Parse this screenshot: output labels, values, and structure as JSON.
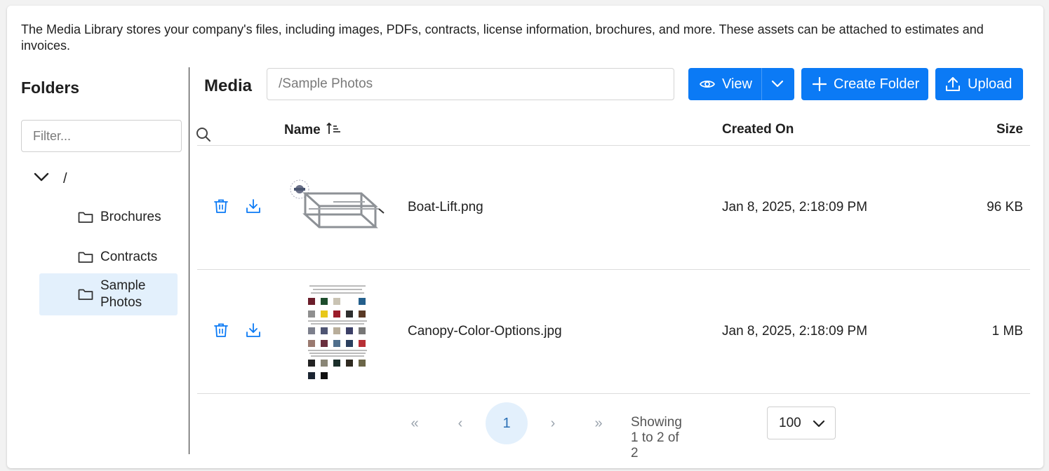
{
  "intro_text": "The Media Library stores your company's files, including images, PDFs, contracts, license information, brochures, and more. These assets can be attached to estimates and invoices.",
  "sidebar": {
    "title": "Folders",
    "filter_placeholder": "Filter...",
    "root_label": "/",
    "folders": [
      {
        "label": "Brochures",
        "selected": false
      },
      {
        "label": "Contracts",
        "selected": false
      },
      {
        "label": "Sample Photos",
        "selected": true
      }
    ]
  },
  "main": {
    "title": "Media",
    "path_placeholder": "/Sample Photos",
    "buttons": {
      "view": "View",
      "create_folder": "Create Folder",
      "upload": "Upload"
    },
    "columns": {
      "name": "Name",
      "created_on": "Created On",
      "size": "Size"
    },
    "rows": [
      {
        "name": "Boat-Lift.png",
        "created_on": "Jan 8, 2025, 2:18:09 PM",
        "size": "96 KB"
      },
      {
        "name": "Canopy-Color-Options.jpg",
        "created_on": "Jan 8, 2025, 2:18:09 PM",
        "size": "1 MB"
      }
    ]
  },
  "pagination": {
    "first": "«",
    "prev": "‹",
    "current_page": "1",
    "next": "›",
    "last": "»",
    "showing_text": "Showing 1 to 2 of 2",
    "per_page": "100"
  },
  "colors": {
    "accent": "#0b7af5",
    "selected_bg": "#e3f0fc"
  }
}
